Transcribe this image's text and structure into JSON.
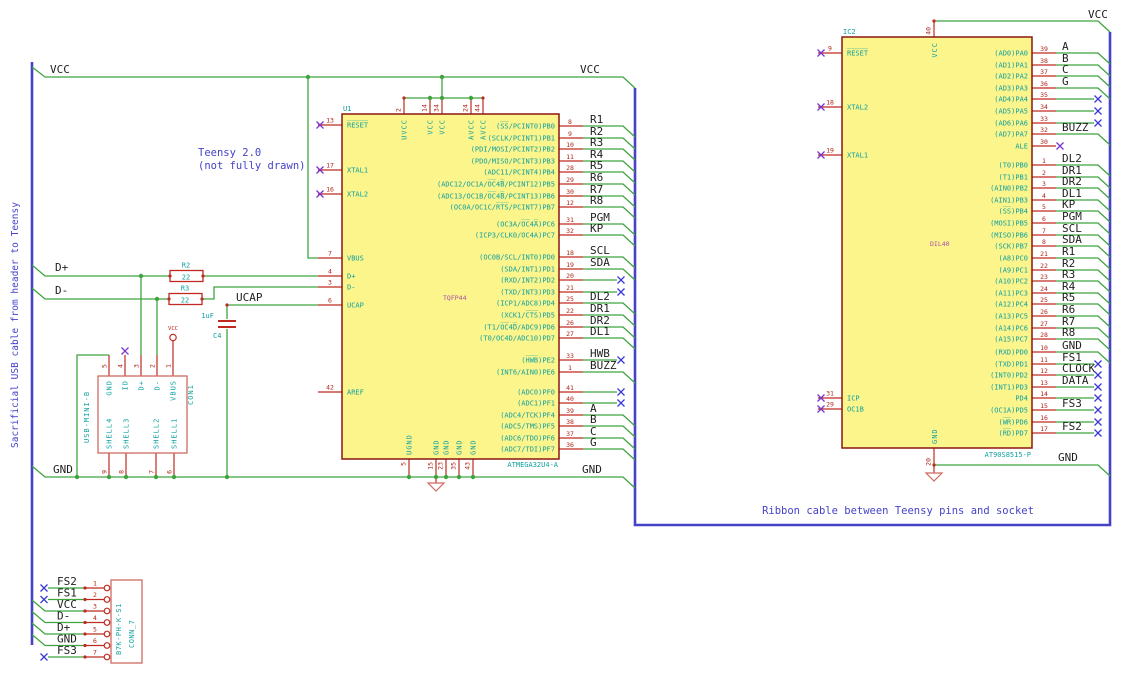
{
  "notes": {
    "teensy1": "Teensy 2.0",
    "teensy2": "(not fully drawn)",
    "usb_cable": "Sacrificial USB cable from header to Teensy",
    "ribbon": "Ribbon cable between Teensy pins and socket"
  },
  "nets": {
    "vcc": "VCC",
    "gnd": "GND",
    "dplus": "D+",
    "dminus": "D-",
    "ucap": "UCAP"
  },
  "colors": {
    "wire_green": "#3fa43f",
    "bus_blue": "#4642c8",
    "pin_red": "#bf2a20",
    "body_fill": "#fbf58c",
    "body_outline": "#8a1710",
    "name_cyan": "#10a0a0",
    "footprint_magenta": "#a850a8",
    "label_black": "#1f1f1f"
  },
  "u1": {
    "ref": "U1",
    "part": "ATMEGA32U4-A",
    "footprint": "TQFP44",
    "left": [
      {
        "n": "13",
        "name": "R̅E̅S̅E̅T̅"
      },
      {
        "n": "17",
        "name": "XTAL1"
      },
      {
        "n": "16",
        "name": "XTAL2"
      },
      {
        "n": "7",
        "name": "VBUS"
      },
      {
        "n": "4",
        "name": "D+"
      },
      {
        "n": "3",
        "name": "D-"
      },
      {
        "n": "6",
        "name": "UCAP"
      },
      {
        "n": "42",
        "name": "AREF"
      }
    ],
    "top": [
      {
        "n": "2",
        "name": "UVCC"
      },
      {
        "n": "14",
        "name": "VCC"
      },
      {
        "n": "34",
        "name": "VCC"
      },
      {
        "n": "24",
        "name": "AVCC"
      },
      {
        "n": "44",
        "name": "AVCC"
      }
    ],
    "bottom": [
      {
        "n": "5",
        "name": "UGND"
      },
      {
        "n": "15",
        "name": "GND"
      },
      {
        "n": "23",
        "name": "GND"
      },
      {
        "n": "35",
        "name": "GND"
      },
      {
        "n": "43",
        "name": "GND"
      }
    ],
    "right": [
      {
        "n": "8",
        "name": "(S̅S̅/PCINT0)PB0",
        "net": "R1",
        "term": "bus"
      },
      {
        "n": "9",
        "name": "(SCLK/PCINT1)PB1",
        "net": "R2",
        "term": "bus"
      },
      {
        "n": "10",
        "name": "(PDI/MOSI/PCINT2)PB2",
        "net": "R3",
        "term": "bus"
      },
      {
        "n": "11",
        "name": "(PDO/MISO/PCINT3)PB3",
        "net": "R4",
        "term": "bus"
      },
      {
        "n": "28",
        "name": "(ADC11/PCINT4)PB4",
        "net": "R5",
        "term": "bus"
      },
      {
        "n": "29",
        "name": "(ADC12/OC1A/O̅C̅4̅B̅/PCINT12)PB5",
        "net": "R6",
        "term": "bus"
      },
      {
        "n": "30",
        "name": "(ADC13/OC1B/O̅C̅4̅B̅/PCINT13)PB6",
        "net": "R7",
        "term": "bus"
      },
      {
        "n": "12",
        "name": "(OC0A/OC1C/R̅T̅S̅/PCINT7)PB7",
        "net": "R8",
        "term": "bus"
      },
      {
        "n": "31",
        "name": "(OC3A/O̅C̅4̅A̅)PC6",
        "net": "PGM",
        "term": "bus"
      },
      {
        "n": "32",
        "name": "(ICP3/CLK0/OC4A)PC7",
        "net": "KP",
        "term": "bus"
      },
      {
        "n": "18",
        "name": "(OC0B/SCL/INT0)PD0",
        "net": "SCL",
        "term": "bus"
      },
      {
        "n": "19",
        "name": "(SDA/INT1)PD1",
        "net": "SDA",
        "term": "bus"
      },
      {
        "n": "20",
        "name": "(RXD/INT2)PD2",
        "net": "",
        "term": "nc"
      },
      {
        "n": "21",
        "name": "(TXD/INT3)PD3",
        "net": "",
        "term": "nc"
      },
      {
        "n": "25",
        "name": "(ICP1/ADC8)PD4",
        "net": "DL2",
        "term": "bus"
      },
      {
        "n": "22",
        "name": "(XCK1/C̅T̅S̅)PD5",
        "net": "DR1",
        "term": "bus"
      },
      {
        "n": "26",
        "name": "(T1/O̅C̅4̅D̅/ADC9)PD6",
        "net": "DR2",
        "term": "bus"
      },
      {
        "n": "27",
        "name": "(T0/OC4D/ADC10)PD7",
        "net": "DL1",
        "term": "bus"
      },
      {
        "n": "33",
        "name": "(H̅W̅B̅)PE2",
        "net": "HWB",
        "term": "nc"
      },
      {
        "n": "1",
        "name": "(INT6/AIN0)PE6",
        "net": "BUZZ",
        "term": "bus"
      },
      {
        "n": "41",
        "name": "(ADC0)PF0",
        "net": "",
        "term": "nc"
      },
      {
        "n": "40",
        "name": "(ADC1)PF1",
        "net": "",
        "term": "nc"
      },
      {
        "n": "39",
        "name": "(ADC4/TCK)PF4",
        "net": "A",
        "term": "bus"
      },
      {
        "n": "38",
        "name": "(ADC5/TMS)PF5",
        "net": "B",
        "term": "bus"
      },
      {
        "n": "37",
        "name": "(ADC6/TDO)PF6",
        "net": "C",
        "term": "bus"
      },
      {
        "n": "36",
        "name": "(ADC7/TDI)PF7",
        "net": "G",
        "term": "bus"
      }
    ]
  },
  "ic2": {
    "ref": "IC2",
    "part": "AT90S8515-P",
    "footprint": "DIL40",
    "left": [
      {
        "n": "9",
        "name": "R̅E̅S̅E̅T̅"
      },
      {
        "n": "18",
        "name": "XTAL2"
      },
      {
        "n": "19",
        "name": "XTAL1"
      },
      {
        "n": "31",
        "name": "ICP"
      },
      {
        "n": "29",
        "name": "OC1B"
      }
    ],
    "top": [
      {
        "n": "40",
        "name": "VCC"
      }
    ],
    "bottom": [
      {
        "n": "20",
        "name": "GND"
      }
    ],
    "right": [
      {
        "n": "39",
        "name": "(AD0)PA0",
        "net": "A",
        "term": "bus"
      },
      {
        "n": "38",
        "name": "(AD1)PA1",
        "net": "B",
        "term": "bus"
      },
      {
        "n": "37",
        "name": "(AD2)PA2",
        "net": "C",
        "term": "bus"
      },
      {
        "n": "36",
        "name": "(AD3)PA3",
        "net": "G",
        "term": "bus"
      },
      {
        "n": "35",
        "name": "(AD4)PA4",
        "net": "",
        "term": "nc"
      },
      {
        "n": "34",
        "name": "(AD5)PA5",
        "net": "",
        "term": "nc"
      },
      {
        "n": "33",
        "name": "(AD6)PA6",
        "net": "",
        "term": "nc"
      },
      {
        "n": "32",
        "name": "(AD7)PA7",
        "net": "BUZZ",
        "term": "bus"
      },
      {
        "n": "30",
        "name": "ALE",
        "net": "",
        "term": "ncpin"
      },
      {
        "n": "1",
        "name": "(T0)PB0",
        "net": "DL2",
        "term": "bus"
      },
      {
        "n": "2",
        "name": "(T1)PB1",
        "net": "DR1",
        "term": "bus"
      },
      {
        "n": "3",
        "name": "(AIN0)PB2",
        "net": "DR2",
        "term": "bus"
      },
      {
        "n": "4",
        "name": "(AIN1)PB3",
        "net": "DL1",
        "term": "bus"
      },
      {
        "n": "5",
        "name": "(S̅S̅)PB4",
        "net": "KP",
        "term": "bus"
      },
      {
        "n": "6",
        "name": "(MOSI)PB5",
        "net": "PGM",
        "term": "bus"
      },
      {
        "n": "7",
        "name": "(MISO)PB6",
        "net": "SCL",
        "term": "bus"
      },
      {
        "n": "8",
        "name": "(SCK)PB7",
        "net": "SDA",
        "term": "bus"
      },
      {
        "n": "21",
        "name": "(A8)PC0",
        "net": "R1",
        "term": "bus"
      },
      {
        "n": "22",
        "name": "(A9)PC1",
        "net": "R2",
        "term": "bus"
      },
      {
        "n": "23",
        "name": "(A10)PC2",
        "net": "R3",
        "term": "bus"
      },
      {
        "n": "24",
        "name": "(A11)PC3",
        "net": "R4",
        "term": "bus"
      },
      {
        "n": "25",
        "name": "(A12)PC4",
        "net": "R5",
        "term": "bus"
      },
      {
        "n": "26",
        "name": "(A13)PC5",
        "net": "R6",
        "term": "bus"
      },
      {
        "n": "27",
        "name": "(A14)PC6",
        "net": "R7",
        "term": "bus"
      },
      {
        "n": "28",
        "name": "(A15)PC7",
        "net": "R8",
        "term": "bus"
      },
      {
        "n": "10",
        "name": "(RXD)PD0",
        "net": "GND",
        "term": "bus"
      },
      {
        "n": "11",
        "name": "(TXD)PD1",
        "net": "FS1",
        "term": "nc"
      },
      {
        "n": "12",
        "name": "(INT0)PD2",
        "net": "CLOCK",
        "term": "nc"
      },
      {
        "n": "13",
        "name": "(INT1)PD3",
        "net": "DATA",
        "term": "nc"
      },
      {
        "n": "14",
        "name": "PD4",
        "net": "",
        "term": "nc"
      },
      {
        "n": "15",
        "name": "(OC1A)PD5",
        "net": "FS3",
        "term": "nc"
      },
      {
        "n": "16",
        "name": "(W̅R̅)PD6",
        "net": "",
        "term": "nc"
      },
      {
        "n": "17",
        "name": "(R̅D̅)PD7",
        "net": "FS2",
        "term": "nc"
      }
    ]
  },
  "con1": {
    "ref": "CON1",
    "part": "USB-MINI-B",
    "top": [
      {
        "n": "5",
        "name": "GND"
      },
      {
        "n": "4",
        "name": "ID"
      },
      {
        "n": "3",
        "name": "D+"
      },
      {
        "n": "2",
        "name": "D-"
      },
      {
        "n": "1",
        "name": "VBUS"
      }
    ],
    "bottom": [
      {
        "n": "9",
        "name": "SHELL4"
      },
      {
        "n": "8",
        "name": "SHELL3"
      },
      {
        "n": "7",
        "name": "SHELL2"
      },
      {
        "n": "6",
        "name": "SHELL1"
      }
    ]
  },
  "conn7": {
    "ref": "CONN_7",
    "part": "B7K-PH-K-S1",
    "rows": [
      {
        "n": "1",
        "label": "FS2",
        "nc": true
      },
      {
        "n": "2",
        "label": "FS1",
        "nc": true
      },
      {
        "n": "3",
        "label": "VCC",
        "nc": false
      },
      {
        "n": "4",
        "label": "D-",
        "nc": false
      },
      {
        "n": "5",
        "label": "D+",
        "nc": false
      },
      {
        "n": "6",
        "label": "GND",
        "nc": false
      },
      {
        "n": "7",
        "label": "FS3",
        "nc": true
      }
    ]
  },
  "r2": {
    "ref": "R2",
    "value": "22"
  },
  "r3": {
    "ref": "R3",
    "value": "22"
  },
  "c4": {
    "ref": "C4",
    "value": "1uF"
  },
  "vcc_symbol_label": "VCC"
}
